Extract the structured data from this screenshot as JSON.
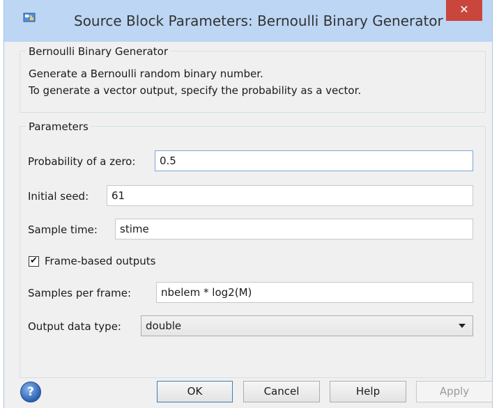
{
  "window": {
    "title": "Source Block Parameters: Bernoulli Binary Generator",
    "close_glyph": "✕"
  },
  "description_group": {
    "legend": "Bernoulli Binary Generator",
    "line1": "Generate a Bernoulli random binary number.",
    "line2": "To generate a vector output, specify the probability as a vector."
  },
  "parameters_group": {
    "legend": "Parameters",
    "probability_label": "Probability of a zero:",
    "probability_value": "0.5",
    "seed_label": "Initial seed:",
    "seed_value": "61",
    "sample_time_label": "Sample time:",
    "sample_time_value": "stime",
    "frame_based_label": "Frame-based outputs",
    "frame_based_checked": true,
    "checkmark_glyph": "✔",
    "samples_per_frame_label": "Samples per frame:",
    "samples_per_frame_value": "nbelem * log2(M)",
    "output_type_label": "Output data type:",
    "output_type_value": "double"
  },
  "buttons": {
    "help_icon_glyph": "?",
    "ok": "OK",
    "cancel": "Cancel",
    "help": "Help",
    "apply": "Apply"
  },
  "colors": {
    "titlebar": "#bcd6f3",
    "close_button": "#c9463d",
    "dialog_background": "#f0f0f0"
  }
}
